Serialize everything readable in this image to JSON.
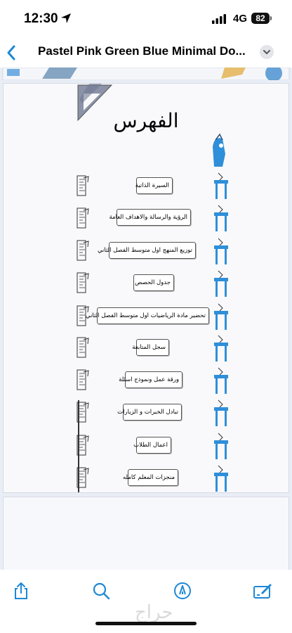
{
  "status_bar": {
    "time": "12:30",
    "network": "4G",
    "battery": "82"
  },
  "nav": {
    "title": "Pastel Pink Green Blue Minimal Do..."
  },
  "index": {
    "title": "الفهرس",
    "entries": [
      {
        "label": "السيرة الذاتية"
      },
      {
        "label": "الرؤية والرسالة والاهداف العامة"
      },
      {
        "label": "توزيع المنهج اول متوسط الفصل الثاني"
      },
      {
        "label": "جدول الحصص"
      },
      {
        "label": "تحضير مادة الرياضيات اول متوسط الفصل الثاني"
      },
      {
        "label": "سجل المتابعة"
      },
      {
        "label": "ورقة عمل ونموذج اسئلة"
      },
      {
        "label": "تبادل الخبرات و الزيارات"
      },
      {
        "label": "اعمال الطلاب"
      },
      {
        "label": "منجزات المعلم كامله"
      }
    ]
  },
  "toolbar": {
    "items": [
      "share-icon",
      "search-icon",
      "markup-icon",
      "edit-icon"
    ],
    "watermark": "حراج"
  },
  "colors": {
    "accent": "#1e88d6",
    "tile_blue": "#2f8fd8"
  }
}
